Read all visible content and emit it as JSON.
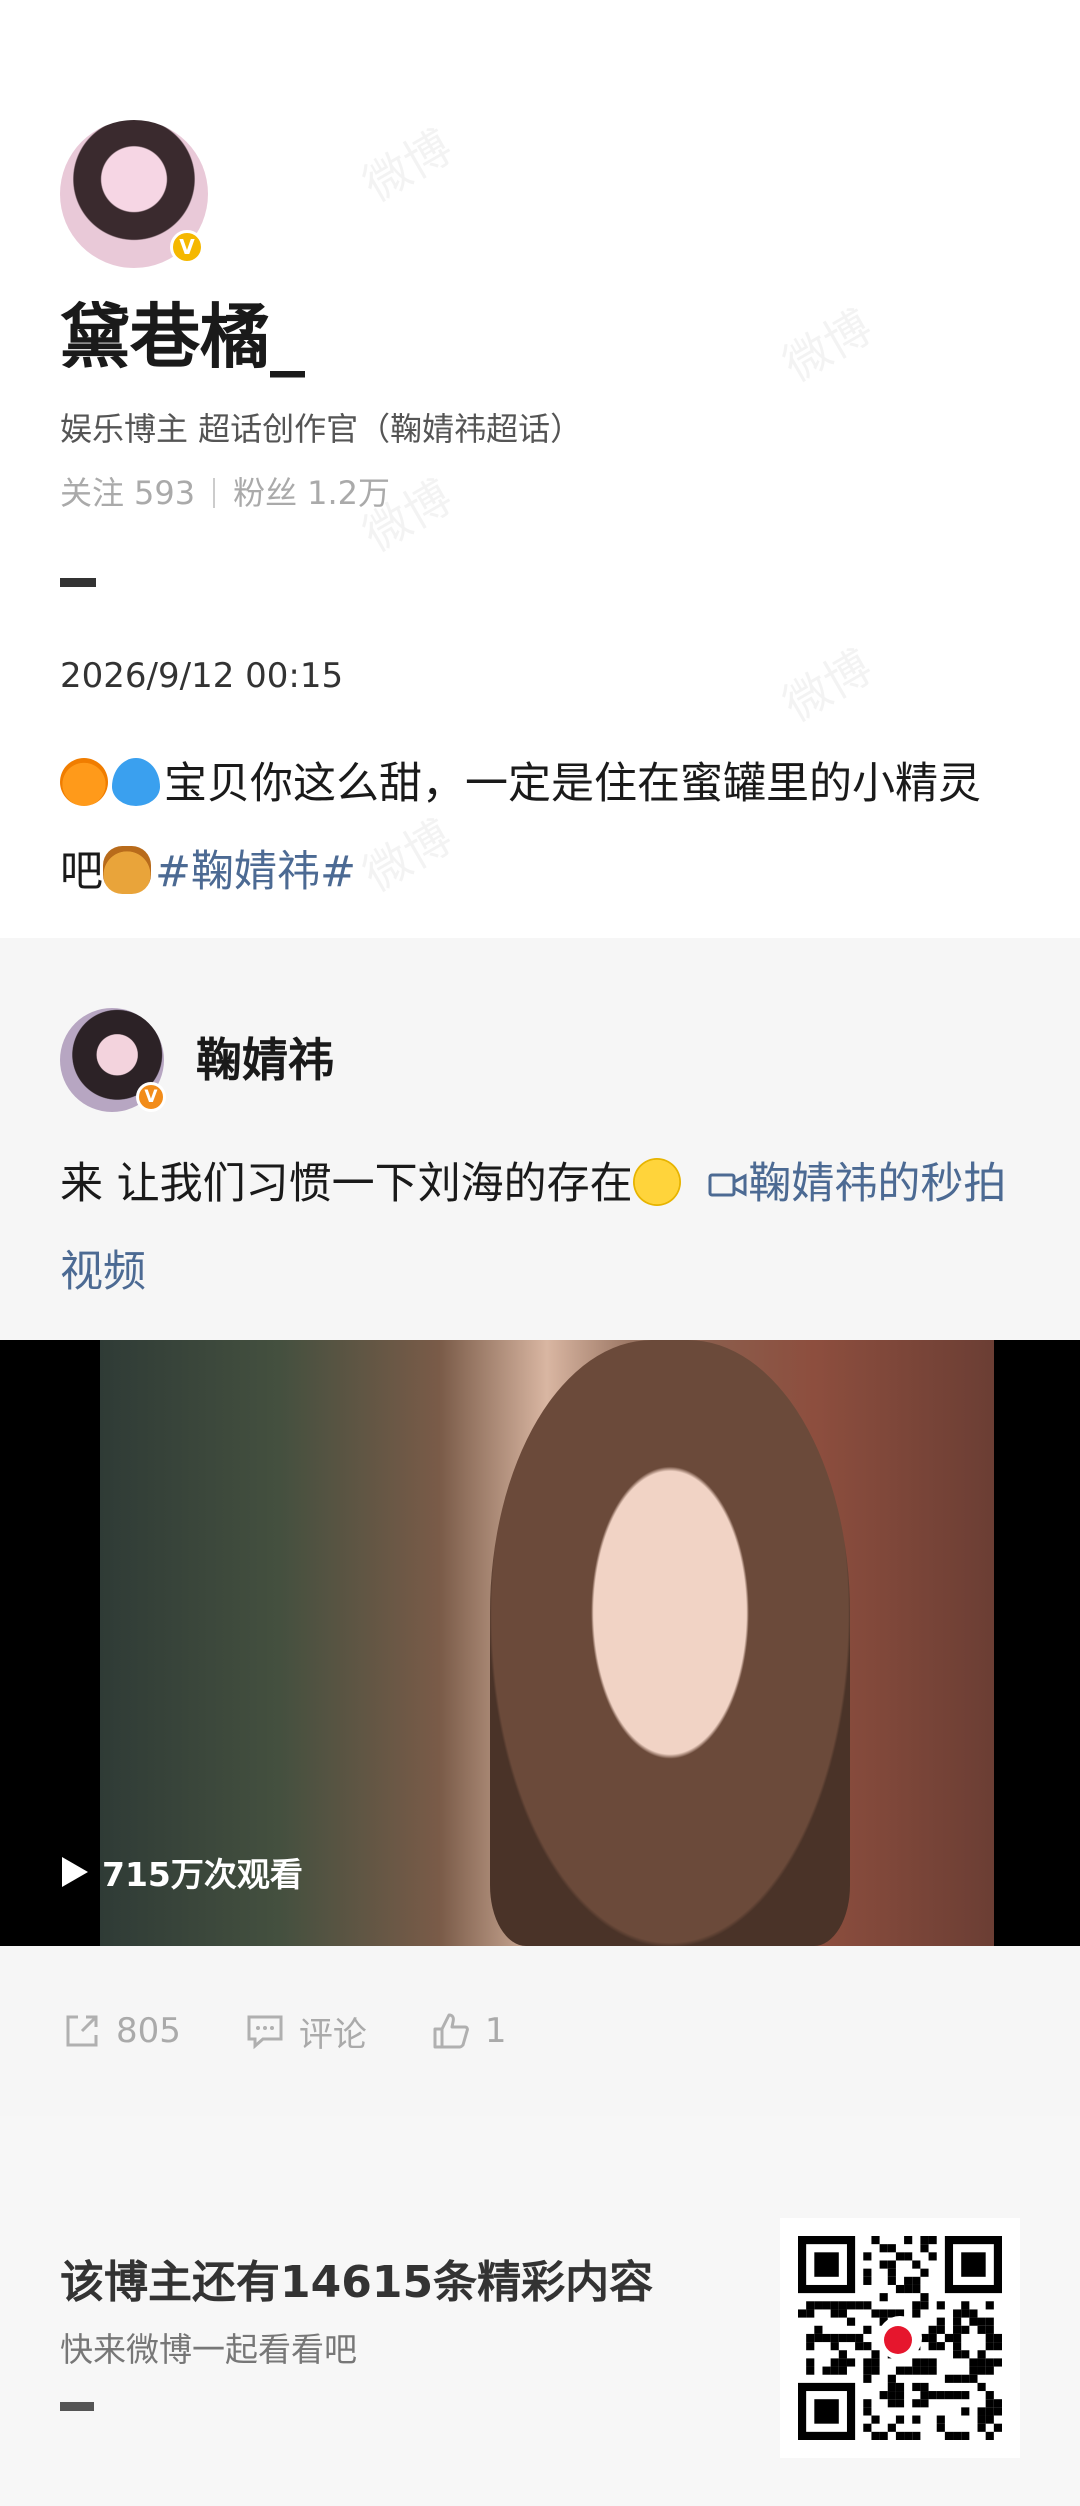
{
  "watermark": "微博",
  "profile": {
    "name": "黛巷橘_",
    "bio": "娱乐博主 超话创作官（鞠婧祎超话）",
    "following_label": "关注",
    "following_count": "593",
    "followers_label": "粉丝",
    "followers_count": "1.2万",
    "verified_badge": "V"
  },
  "post": {
    "date": "2026/9/12 00:15",
    "emoji_1": "orange-emoji",
    "emoji_2": "blue-heart-emoji",
    "text": "宝贝你这么甜，一定是住在蜜罐里的小精灵吧",
    "emoji_3": "honey-pot-emoji",
    "topic": "#鞠婧祎#"
  },
  "repost": {
    "author": "鞠婧祎",
    "verified_badge": "V",
    "text": "来 让我们习惯一下刘海的存在",
    "emoji": "smiley-emoji",
    "video_link": "鞠婧祎的秒拍视频",
    "views": "715万次观看"
  },
  "actions": {
    "share_count": "805",
    "comment_label": "评论",
    "like_count": "1"
  },
  "footer": {
    "title": "该博主还有14615条精彩内容",
    "subtitle": "快来微博一起看看吧"
  },
  "colors": {
    "topic": "#4c6a93",
    "badge_yellow": "#f5b800",
    "badge_orange": "#f28c1a"
  }
}
